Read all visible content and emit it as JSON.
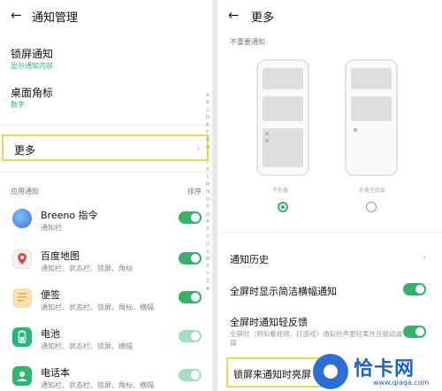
{
  "left": {
    "title": "通知管理",
    "lock_screen": {
      "title": "锁屏通知",
      "value": "显示通知内容"
    },
    "badge": {
      "title": "桌面角标",
      "value": "数字"
    },
    "more_label": "更多",
    "section_header": "应用通知",
    "sort_label": "排序",
    "alphabet": [
      "A",
      "B",
      "C",
      "D",
      "E",
      "F",
      "G",
      "H",
      "I",
      "J",
      "K",
      "L",
      "M",
      "N",
      "O",
      "P",
      "Q",
      "R",
      "S",
      "T",
      "U",
      "V",
      "W",
      "X",
      "Y",
      "Z",
      "#"
    ],
    "apps": [
      {
        "name": "Breeno 指令",
        "sub": "通知栏",
        "enabled": true
      },
      {
        "name": "百度地图",
        "sub": "通知栏、状态栏、锁屏、角标",
        "enabled": true
      },
      {
        "name": "便签",
        "sub": "通知栏、状态栏、锁屏、角标、横幅",
        "enabled": true
      },
      {
        "name": "电池",
        "sub": "通知栏、状态栏、锁屏、横幅",
        "enabled": true
      },
      {
        "name": "电话本",
        "sub": "通知栏、状态栏、锁屏、角标、横幅",
        "enabled": true
      }
    ]
  },
  "right": {
    "title": "更多",
    "section_header": "不重要通知",
    "options": [
      {
        "label": "不折叠",
        "selected": true
      },
      {
        "label": "折叠至底部",
        "selected": false
      }
    ],
    "history_label": "通知历史",
    "fullscreen_banner": {
      "title": "全屏时显示简洁横幅通知",
      "enabled": true
    },
    "fullscreen_light": {
      "title": "全屏时通知轻反馈",
      "desc": "全屏时（例如看视频、打游戏）通知铃声更轻柔并且振动减弱",
      "enabled": true
    },
    "lock_wake_label": "锁屏来通知时亮屏"
  },
  "watermark": {
    "text": "恰卡网",
    "url": "www.qiaqa.com"
  },
  "colors": {
    "accent": "#35b16a",
    "highlight": "#e1dc55",
    "watermark": "#1f63c9"
  }
}
